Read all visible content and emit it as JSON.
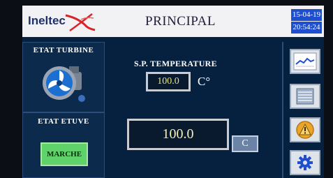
{
  "header": {
    "logo_text": "Ineltec",
    "title": "PRINCIPAL",
    "date": "15-04-19",
    "time": "20:54:24"
  },
  "turbine": {
    "title": "ETAT TURBINE",
    "icon": "fan-icon"
  },
  "etuve": {
    "title": "ETAT ETUVE",
    "button_label": "MARCHE"
  },
  "setpoint": {
    "label": "S.P. TEMPERATURE",
    "value": "100.0",
    "unit": "C°"
  },
  "measurement": {
    "value": "100.0",
    "unit_button": "C"
  },
  "sidebar": {
    "buttons": [
      {
        "icon": "trend-chart-icon"
      },
      {
        "icon": "list-icon"
      },
      {
        "icon": "alarm-icon"
      },
      {
        "icon": "gear-icon"
      }
    ]
  },
  "colors": {
    "background": "#06213f",
    "header": "#f2f2f4",
    "clock": "#1f4fcf",
    "marche": "#5fd36a",
    "value_text": "#e7e37a",
    "alarm": "#e9a62a"
  }
}
